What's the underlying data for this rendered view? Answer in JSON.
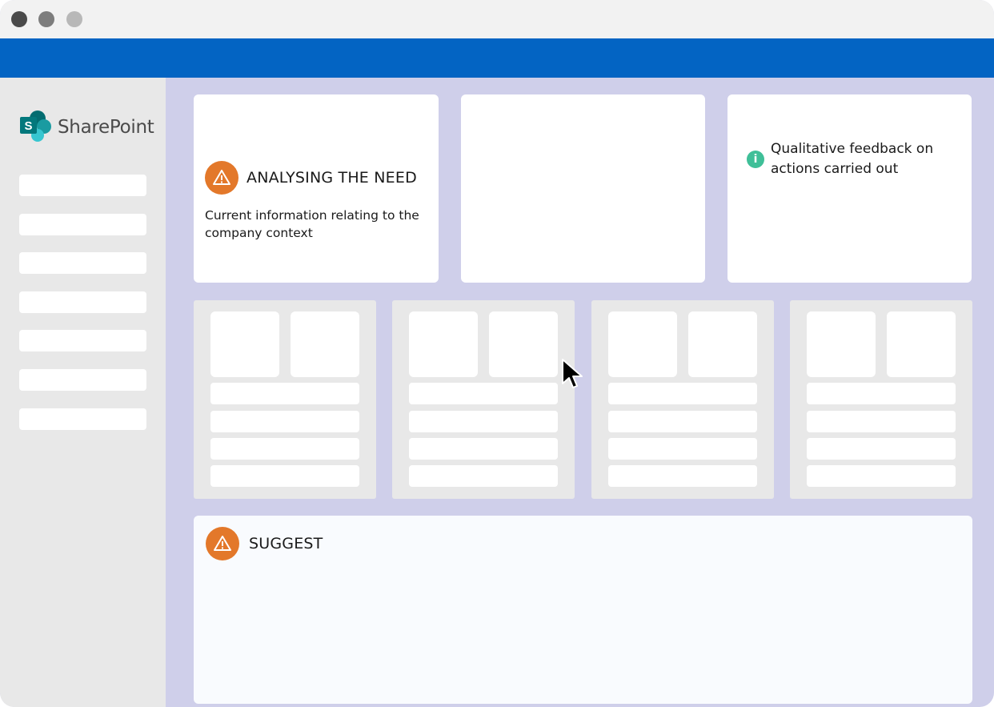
{
  "window": {
    "controls": [
      "close",
      "minimize",
      "maximize"
    ]
  },
  "colors": {
    "topbar": "#0364c3",
    "content_bg": "#cfcfea",
    "sidebar_bg": "#e8e8e8",
    "warning": "#e3782a",
    "info": "#3fbf98"
  },
  "sidebar": {
    "logo_icon": "sharepoint-logo-icon",
    "logo_text": "SharePoint",
    "item_count": 7
  },
  "cards": {
    "analysing": {
      "icon": "warning-icon",
      "title": "ANALYSING THE NEED",
      "description": "Current information relating to the company context"
    },
    "feedback": {
      "icon": "info-icon",
      "icon_glyph": "i",
      "text": "Qualitative feedback on actions carried out"
    },
    "suggest": {
      "icon": "warning-icon",
      "title": "SUGGEST"
    }
  },
  "cursor": {
    "icon": "mouse-pointer-icon"
  }
}
